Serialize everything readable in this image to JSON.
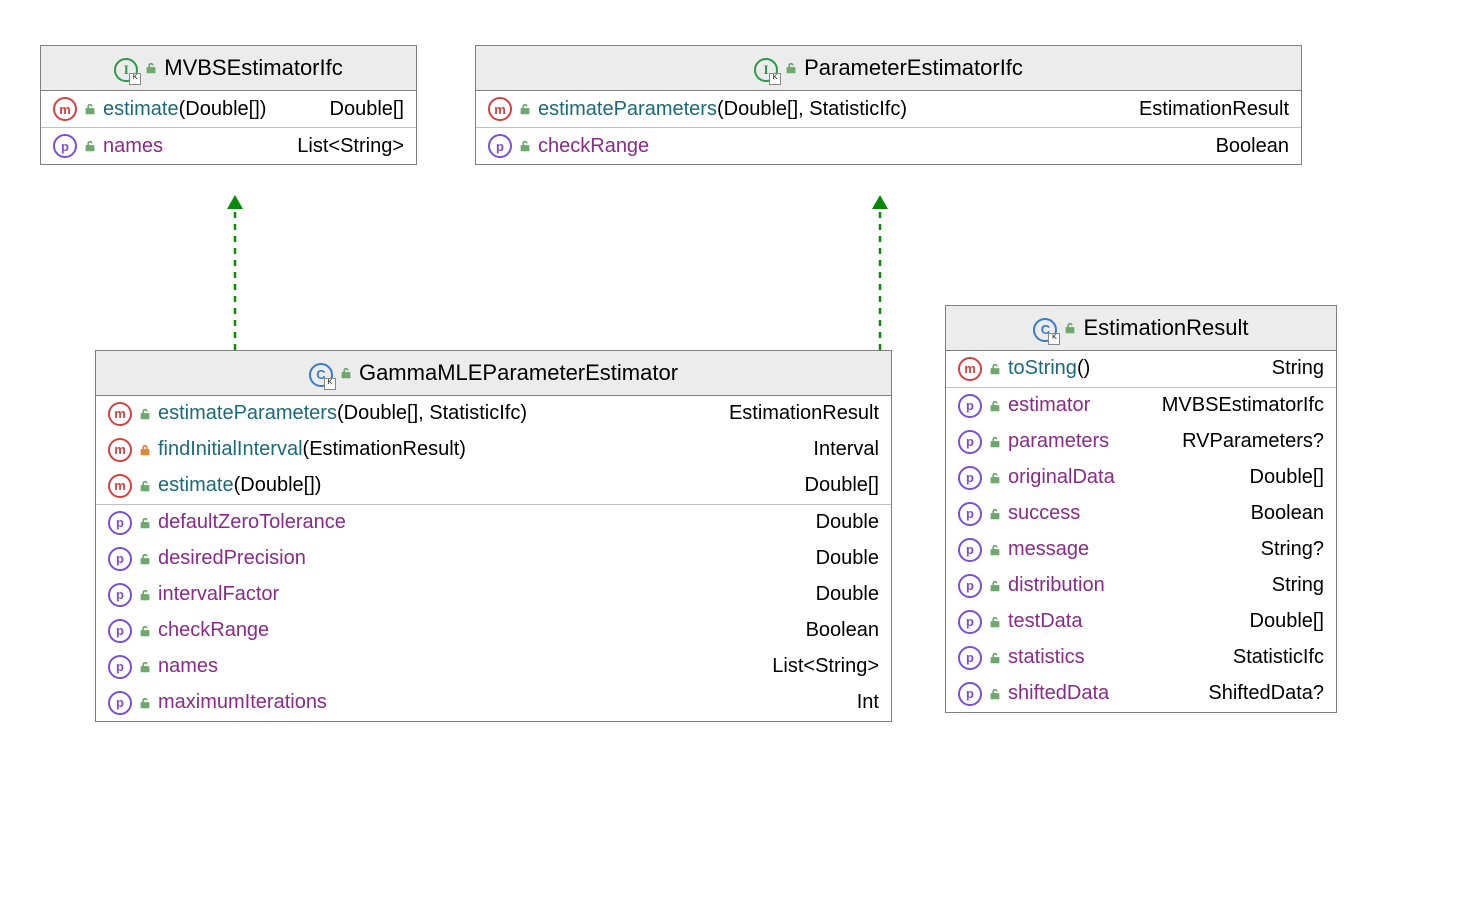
{
  "interfaces": {
    "mvbs": {
      "title": "MVBSEstimatorIfc",
      "methods": [
        {
          "name": "estimate",
          "params": "(Double[])",
          "ret": "Double[]"
        }
      ],
      "properties": [
        {
          "name": "names",
          "type": "List<String>"
        }
      ]
    },
    "param": {
      "title": "ParameterEstimatorIfc",
      "methods": [
        {
          "name": "estimateParameters",
          "params": "(Double[], StatisticIfc)",
          "ret": "EstimationResult"
        }
      ],
      "properties": [
        {
          "name": "checkRange",
          "type": "Boolean"
        }
      ]
    }
  },
  "classes": {
    "gamma": {
      "title": "GammaMLEParameterEstimator",
      "methods": [
        {
          "name": "estimateParameters",
          "params": "(Double[], StatisticIfc)",
          "ret": "EstimationResult",
          "vis": "open"
        },
        {
          "name": "findInitialInterval",
          "params": "(EstimationResult)",
          "ret": "Interval",
          "vis": "private"
        },
        {
          "name": "estimate",
          "params": "(Double[])",
          "ret": "Double[]",
          "vis": "open"
        }
      ],
      "properties": [
        {
          "name": "defaultZeroTolerance",
          "type": "Double"
        },
        {
          "name": "desiredPrecision",
          "type": "Double"
        },
        {
          "name": "intervalFactor",
          "type": "Double"
        },
        {
          "name": "checkRange",
          "type": "Boolean"
        },
        {
          "name": "names",
          "type": "List<String>"
        },
        {
          "name": "maximumIterations",
          "type": "Int"
        }
      ]
    },
    "result": {
      "title": "EstimationResult",
      "methods": [
        {
          "name": "toString",
          "params": "()",
          "ret": "String"
        }
      ],
      "properties": [
        {
          "name": "estimator",
          "type": "MVBSEstimatorIfc"
        },
        {
          "name": "parameters",
          "type": "RVParameters?"
        },
        {
          "name": "originalData",
          "type": "Double[]"
        },
        {
          "name": "success",
          "type": "Boolean"
        },
        {
          "name": "message",
          "type": "String?"
        },
        {
          "name": "distribution",
          "type": "String"
        },
        {
          "name": "testData",
          "type": "Double[]"
        },
        {
          "name": "statistics",
          "type": "StatisticIfc"
        },
        {
          "name": "shiftedData",
          "type": "ShiftedData?"
        }
      ]
    }
  }
}
